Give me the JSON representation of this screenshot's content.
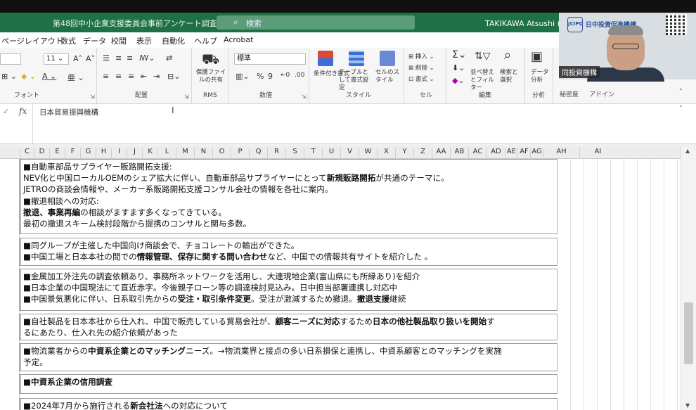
{
  "window": {
    "title": "第48回中小企業支援委員会事前アンケート調査(追成…",
    "search_placeholder": "検索",
    "user": "TAKIKAWA Atsushi (瀧川"
  },
  "tabs": [
    "ページレイアウト",
    "数式",
    "データ",
    "校閲",
    "表示",
    "自動化",
    "ヘルプ",
    "Acrobat"
  ],
  "ribbon": {
    "font_size": "11",
    "font_group": "フォント",
    "align_group": "配置",
    "rms_label": "保護ファイルの共有",
    "rms_group": "RMS",
    "number_format": "標準",
    "number_group": "数値",
    "cond_format": "条件付き書式",
    "table_format": "テーブルとして書式設定",
    "cell_style": "セルのスタイル",
    "style_group": "スタイル",
    "insert": "挿入",
    "delete": "削除",
    "format": "書式",
    "cells_group": "セル",
    "sort_filter": "並べ替えとフィルター",
    "find_select": "検索と選択",
    "edit_group": "編集",
    "data_analysis": "データ分析",
    "analysis_group": "分析",
    "sensitivity_group": "秘密度",
    "addin_group": "アドイン"
  },
  "webcam": {
    "org_logo_text": "日中投資促進機構",
    "name_tag": "同投資機構"
  },
  "formula_bar": {
    "fx": "fx",
    "content": "日本貿易振興機構"
  },
  "columns": [
    "C",
    "D",
    "E",
    "F",
    "G",
    "H",
    "I",
    "J",
    "K",
    "L",
    "M",
    "N",
    "O",
    "P",
    "Q",
    "R",
    "S",
    "T",
    "U",
    "V",
    "W",
    "X",
    "Y",
    "Z",
    "AA",
    "AB",
    "AC",
    "AD",
    "AE",
    "AF",
    "AG",
    "AH",
    "AI"
  ],
  "cells": [
    {
      "lines": [
        [
          {
            "t": "■自動車部品サプライヤー販路開拓支援:"
          }
        ],
        [
          {
            "t": "NEV化と中国ローカルOEMのシェア拡大に伴い、自動車部品サプライヤーにとって"
          },
          {
            "t": "新規販路開拓",
            "b": true
          },
          {
            "t": "が共通のテーマに。"
          }
        ],
        [
          {
            "t": "JETROの商談会情報や、メーカー系販路開拓支援コンサル会社の情報を各社に案内。"
          }
        ],
        [
          {
            "t": "■撤退相談への対応:"
          }
        ],
        [
          {
            "t": "撤退、事業再編",
            "b": true
          },
          {
            "t": "の相談がますます多くなってきている。"
          }
        ],
        [
          {
            "t": "最初の撤退スキーム検討段階から提携のコンサルと関与多数。"
          }
        ]
      ]
    },
    {
      "lines": [
        [
          {
            "t": "■同グループが主催した中国向け商談会で、チョコレートの輸出ができた。"
          }
        ],
        [
          {
            "t": "■中国工場と日本本社の間での"
          },
          {
            "t": "情報管理、保存に関する問い合わせ",
            "b": true
          },
          {
            "t": "など、中国での情報共有サイトを紹介した 。"
          }
        ]
      ]
    },
    {
      "lines": [
        [
          {
            "t": "■金属加工外注先の調査依頼あり、事務所ネットワークを活用し、大連現地企業(富山県にも所縁あり)を紹介"
          }
        ],
        [
          {
            "t": "■日本企業の中国現法にて直近赤字。今後親子ローン等の調達検討見込み。日中担当部署連携し対応中"
          }
        ],
        [
          {
            "t": "■中国景気悪化に伴い、日系取引先からの"
          },
          {
            "t": "受注・取引条件変更",
            "b": true
          },
          {
            "t": "。受注が激減するため撤退。"
          },
          {
            "t": "撤退支援",
            "b": true
          },
          {
            "t": "継続"
          }
        ]
      ]
    },
    {
      "lines": [
        [
          {
            "t": "■自社製品を日本本社から仕入れ、中国で販売している貿易会社が、"
          },
          {
            "t": "顧客ニーズに対応",
            "b": true
          },
          {
            "t": "するため"
          },
          {
            "t": "日本の他社製品取り扱いを開始",
            "b": true
          },
          {
            "t": "す"
          }
        ],
        [
          {
            "t": "るにあたり、仕入れ先の紹介依頼があった"
          }
        ]
      ]
    },
    {
      "lines": [
        [
          {
            "t": "■物流業者からの"
          },
          {
            "t": "中資系企業とのマッチング",
            "b": true
          },
          {
            "t": "ニーズ。→物流業界と接点の多い日系損保と連携し、中資系顧客とのマッチングを実施"
          }
        ],
        [
          {
            "t": "予定。"
          }
        ]
      ]
    },
    {
      "lines": [
        [
          {
            "t": "■中資系企業の信用調査",
            "b": true
          }
        ]
      ]
    },
    {
      "lines": [
        [
          {
            "t": "■2024年7月から施行される"
          },
          {
            "t": "新会社法",
            "b": true
          },
          {
            "t": "への対応について"
          }
        ]
      ]
    }
  ]
}
